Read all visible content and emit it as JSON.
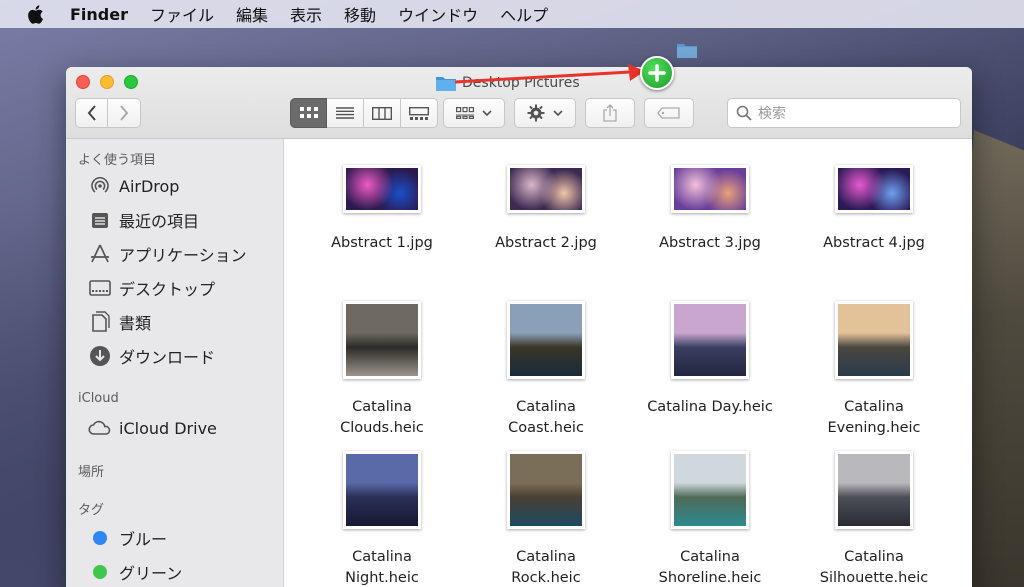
{
  "menubar": {
    "app_name": "Finder",
    "items": [
      "ファイル",
      "編集",
      "表示",
      "移動",
      "ウインドウ",
      "ヘルプ"
    ]
  },
  "window": {
    "title": "Desktop Pictures",
    "search_placeholder": "検索"
  },
  "sidebar": {
    "favorites_header": "よく使う項目",
    "favorites": [
      {
        "label": "AirDrop",
        "icon": "airdrop-icon"
      },
      {
        "label": "最近の項目",
        "icon": "recents-icon"
      },
      {
        "label": "アプリケーション",
        "icon": "applications-icon"
      },
      {
        "label": "デスクトップ",
        "icon": "desktop-icon"
      },
      {
        "label": "書類",
        "icon": "documents-icon"
      },
      {
        "label": "ダウンロード",
        "icon": "downloads-icon"
      }
    ],
    "icloud_header": "iCloud",
    "icloud_items": [
      {
        "label": "iCloud Drive",
        "icon": "cloud-icon"
      }
    ],
    "locations_header": "場所",
    "tags_header": "タグ",
    "tags": [
      {
        "label": "ブルー",
        "color": "#2f86f6"
      },
      {
        "label": "グリーン",
        "color": "#3fc64c"
      }
    ]
  },
  "files": [
    {
      "name": "Abstract 1.jpg",
      "kind": "abstract",
      "colors": [
        "#f05ac4",
        "#2b1a4f",
        "#1a4fc9"
      ]
    },
    {
      "name": "Abstract 2.jpg",
      "kind": "abstract",
      "colors": [
        "#d9b7c9",
        "#3d2a52",
        "#f0c7a8"
      ]
    },
    {
      "name": "Abstract 3.jpg",
      "kind": "abstract",
      "colors": [
        "#f2c0d9",
        "#6a3f9a",
        "#e9a27a"
      ]
    },
    {
      "name": "Abstract 4.jpg",
      "kind": "abstract",
      "colors": [
        "#e85ad0",
        "#2a1a55",
        "#6ea0f0"
      ]
    },
    {
      "name": "Catalina\nClouds.heic",
      "kind": "photo",
      "colors": [
        "#6e6a62",
        "#2d2b28",
        "#9b958a"
      ]
    },
    {
      "name": "Catalina\nCoast.heic",
      "kind": "photo",
      "colors": [
        "#8aa0b8",
        "#3a3628",
        "#1a2a3a"
      ]
    },
    {
      "name": "Catalina Day.heic",
      "kind": "photo",
      "colors": [
        "#c9a6cf",
        "#3a3f62",
        "#22263f"
      ]
    },
    {
      "name": "Catalina\nEvening.heic",
      "kind": "photo",
      "colors": [
        "#e3c29a",
        "#4a4740",
        "#2a3a4a"
      ]
    },
    {
      "name": "Catalina\nNight.heic",
      "kind": "photo",
      "colors": [
        "#5a6aa8",
        "#2a2f55",
        "#151935"
      ]
    },
    {
      "name": "Catalina\nRock.heic",
      "kind": "photo",
      "colors": [
        "#7b6e58",
        "#4a4033",
        "#1c4a63"
      ]
    },
    {
      "name": "Catalina\nShoreline.heic",
      "kind": "photo",
      "colors": [
        "#cfd8dc",
        "#4e6a58",
        "#2f8a8f"
      ]
    },
    {
      "name": "Catalina\nSilhouette.heic",
      "kind": "photo",
      "colors": [
        "#b8b8bd",
        "#4d4f58",
        "#2a2c34"
      ]
    }
  ]
}
